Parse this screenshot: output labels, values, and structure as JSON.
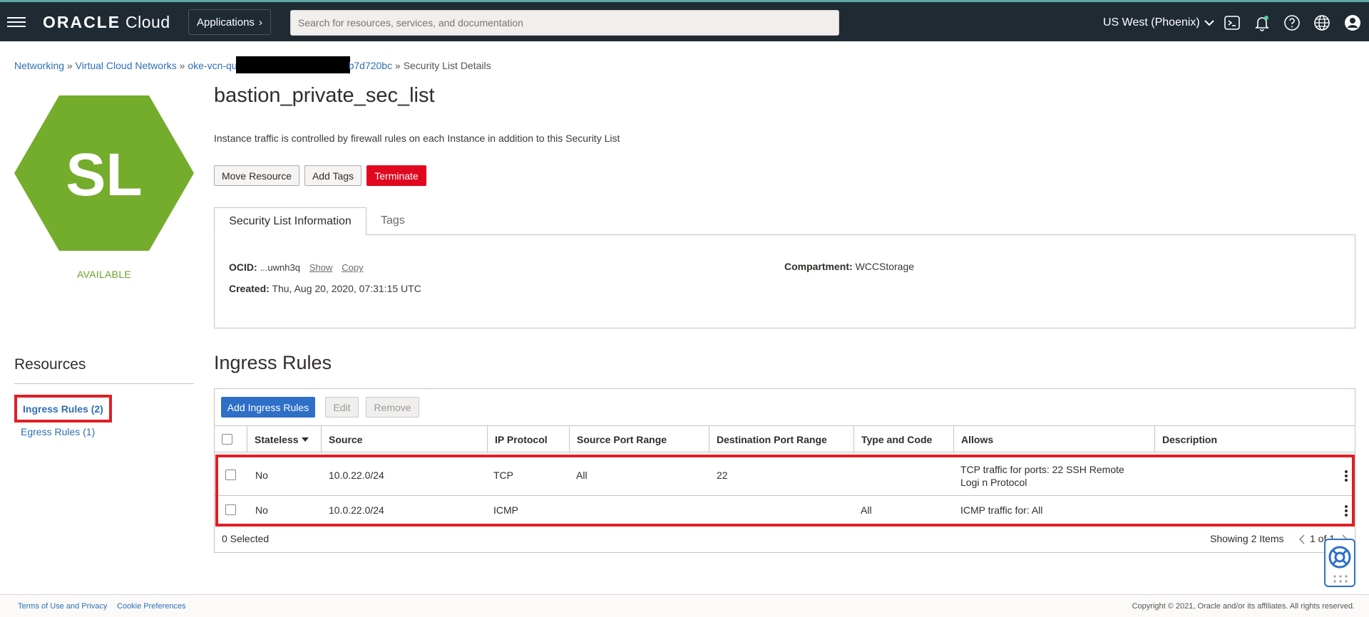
{
  "topbar": {
    "logo_brand": "ORACLE",
    "logo_cloud": "Cloud",
    "apps_label": "Applications",
    "search_placeholder": "Search for resources, services, and documentation",
    "region": "US West (Phoenix)"
  },
  "breadcrumb": {
    "items": [
      "Networking",
      "Virtual Cloud Networks",
      "oke-vcn-qu",
      "b7d720bc"
    ],
    "separator": "»",
    "current": "Security List Details"
  },
  "resource": {
    "initials": "SL",
    "status": "AVAILABLE",
    "hex_color": "#74ac2c",
    "title": "bastion_private_sec_list",
    "description": "Instance traffic is controlled by firewall rules on each Instance in addition to this Security List"
  },
  "actions": {
    "move": "Move Resource",
    "tags": "Add Tags",
    "terminate": "Terminate"
  },
  "tabs": [
    "Security List Information",
    "Tags"
  ],
  "info": {
    "ocid_label": "OCID:",
    "ocid_value": "...uwnh3q",
    "show": "Show",
    "copy": "Copy",
    "created_label": "Created:",
    "created_value": "Thu, Aug 20, 2020, 07:31:15 UTC",
    "compartment_label": "Compartment:",
    "compartment_value": "WCCStorage"
  },
  "resources": {
    "title": "Resources",
    "items": [
      "Ingress Rules (2)",
      "Egress Rules (1)"
    ]
  },
  "ingress": {
    "title": "Ingress Rules",
    "add": "Add Ingress Rules",
    "edit": "Edit",
    "remove": "Remove",
    "columns": [
      "Stateless",
      "Source",
      "IP Protocol",
      "Source Port Range",
      "Destination Port Range",
      "Type and Code",
      "Allows",
      "Description"
    ],
    "rows": [
      {
        "stateless": "No",
        "source": "10.0.22.0/24",
        "protocol": "TCP",
        "src_port": "All",
        "dst_port": "22",
        "type_code": "",
        "allows": "TCP traffic for ports: 22 SSH Remote Logi n Protocol",
        "description": ""
      },
      {
        "stateless": "No",
        "source": "10.0.22.0/24",
        "protocol": "ICMP",
        "src_port": "",
        "dst_port": "",
        "type_code": "All",
        "allows": "ICMP traffic for: All",
        "description": ""
      }
    ],
    "selected": "0 Selected",
    "showing": "Showing 2 Items",
    "page": "1 of 1"
  },
  "footer": {
    "terms": "Terms of Use and Privacy",
    "cookies": "Cookie Preferences",
    "copyright": "Copyright © 2021, Oracle and/or its affiliates. All rights reserved."
  }
}
